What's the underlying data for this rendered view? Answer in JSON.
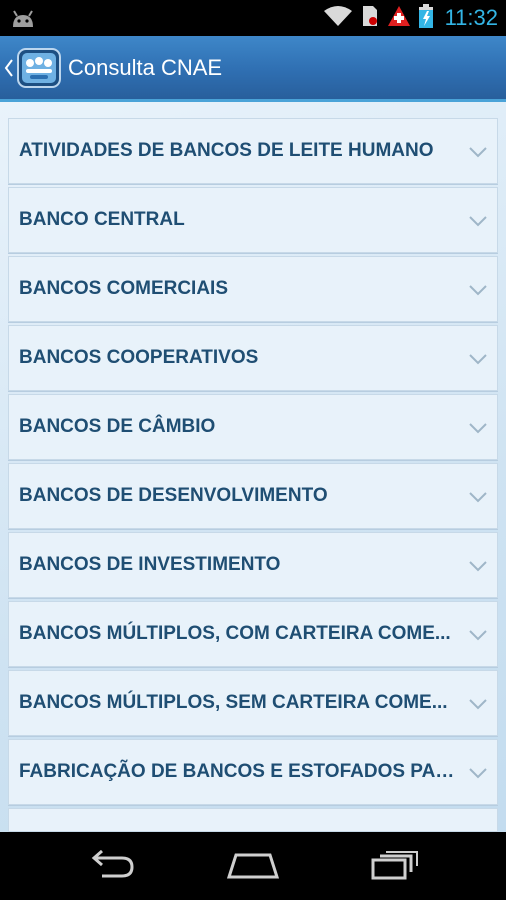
{
  "status_bar": {
    "time": "11:32",
    "icons": [
      "android-icon",
      "wifi-icon",
      "sd-card-icon",
      "swiss-flag-icon",
      "battery-charging-icon"
    ]
  },
  "action_bar": {
    "title": "Consulta CNAE",
    "logo_icon": "app-logo-icon",
    "accent_color": "#2f6fb2"
  },
  "list": {
    "items": [
      {
        "label": "ATIVIDADES DE BANCOS DE LEITE HUMANO"
      },
      {
        "label": "BANCO CENTRAL"
      },
      {
        "label": "BANCOS COMERCIAIS"
      },
      {
        "label": "BANCOS COOPERATIVOS"
      },
      {
        "label": "BANCOS DE CÂMBIO"
      },
      {
        "label": "BANCOS DE DESENVOLVIMENTO"
      },
      {
        "label": "BANCOS DE INVESTIMENTO"
      },
      {
        "label": "BANCOS MÚLTIPLOS, COM CARTEIRA COME..."
      },
      {
        "label": "BANCOS MÚLTIPLOS, SEM CARTEIRA COME..."
      },
      {
        "label": "FABRICAÇÃO DE BANCOS E ESTOFADOS PAR..."
      }
    ],
    "text_color": "#1f4e73"
  },
  "nav_bar": {
    "buttons": [
      "back-icon",
      "home-icon",
      "recents-icon"
    ]
  }
}
